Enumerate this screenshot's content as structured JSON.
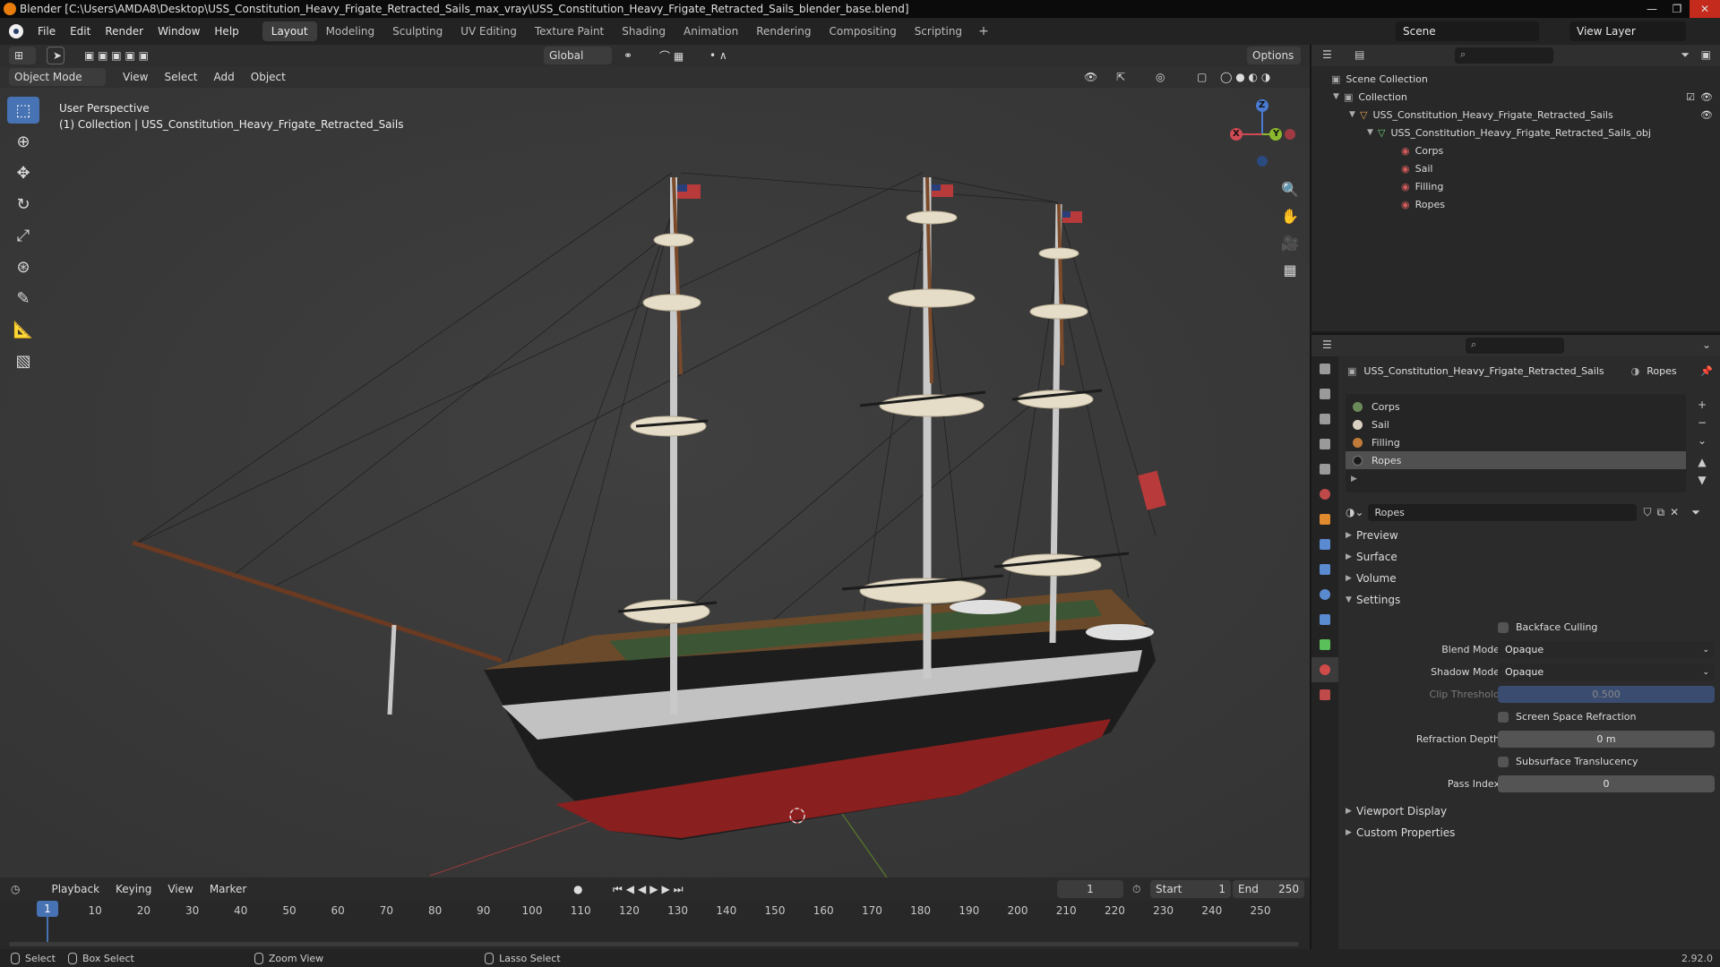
{
  "window": {
    "title": "Blender [C:\\Users\\AMDA8\\Desktop\\USS_Constitution_Heavy_Frigate_Retracted_Sails_max_vray\\USS_Constitution_Heavy_Frigate_Retracted_Sails_blender_base.blend]"
  },
  "menu": [
    "File",
    "Edit",
    "Render",
    "Window",
    "Help"
  ],
  "workspaces": [
    "Layout",
    "Modeling",
    "Sculpting",
    "UV Editing",
    "Texture Paint",
    "Shading",
    "Animation",
    "Rendering",
    "Compositing",
    "Scripting"
  ],
  "active_workspace": "Layout",
  "scene": {
    "name": "Scene",
    "view_layer": "View Layer"
  },
  "viewport_header": {
    "orientation": "Global",
    "options": "Options",
    "mode": "Object Mode",
    "menus": [
      "View",
      "Select",
      "Add",
      "Object"
    ]
  },
  "viewport": {
    "perspective": "User Perspective",
    "collection_info": "(1) Collection | USS_Constitution_Heavy_Frigate_Retracted_Sails",
    "gizmo_labels": {
      "x": "X",
      "y": "Y",
      "z": "Z"
    }
  },
  "timeline": {
    "menus": [
      "Playback",
      "Keying",
      "View",
      "Marker"
    ],
    "current_frame": "1",
    "start_label": "Start",
    "start": "1",
    "end_label": "End",
    "end": "250",
    "ticks": [
      "10",
      "20",
      "30",
      "40",
      "50",
      "60",
      "70",
      "80",
      "90",
      "100",
      "110",
      "120",
      "130",
      "140",
      "150",
      "160",
      "170",
      "180",
      "190",
      "200",
      "210",
      "220",
      "230",
      "240",
      "250"
    ],
    "cursor": "1"
  },
  "statusbar": {
    "select": "Select",
    "box_select": "Box Select",
    "zoom_view": "Zoom View",
    "lasso_select": "Lasso Select",
    "version": "2.92.0"
  },
  "outliner": {
    "root": "Scene Collection",
    "collection": "Collection",
    "object": "USS_Constitution_Heavy_Frigate_Retracted_Sails",
    "mesh": "USS_Constitution_Heavy_Frigate_Retracted_Sails_obj",
    "materials": [
      "Corps",
      "Sail",
      "Filling",
      "Ropes"
    ]
  },
  "properties": {
    "breadcrumb_object": "USS_Constitution_Heavy_Frigate_Retracted_Sails",
    "breadcrumb_material": "Ropes",
    "slots": [
      {
        "name": "Corps",
        "color": "#6b8a5a"
      },
      {
        "name": "Sail",
        "color": "#d8d0c0"
      },
      {
        "name": "Filling",
        "color": "#c07a3a"
      },
      {
        "name": "Ropes",
        "color": "#1a1a1a"
      }
    ],
    "active_slot": "Ropes",
    "material_name": "Ropes",
    "panels": {
      "preview": "Preview",
      "surface": "Surface",
      "volume": "Volume",
      "settings": "Settings",
      "viewport_display": "Viewport Display",
      "custom_properties": "Custom Properties"
    },
    "settings": {
      "backface_culling": "Backface Culling",
      "blend_mode_label": "Blend Mode",
      "blend_mode": "Opaque",
      "shadow_mode_label": "Shadow Mode",
      "shadow_mode": "Opaque",
      "clip_threshold_label": "Clip Threshold",
      "clip_threshold": "0.500",
      "ssr": "Screen Space Refraction",
      "refraction_depth_label": "Refraction Depth",
      "refraction_depth": "0 m",
      "subsurface": "Subsurface Translucency",
      "pass_index_label": "Pass Index",
      "pass_index": "0"
    }
  },
  "colors": {
    "accent": "#4772b3",
    "hull_red": "#8a1f1f",
    "hull_black": "#1c1c1c",
    "viewport_bg": "#3b3b3b"
  }
}
